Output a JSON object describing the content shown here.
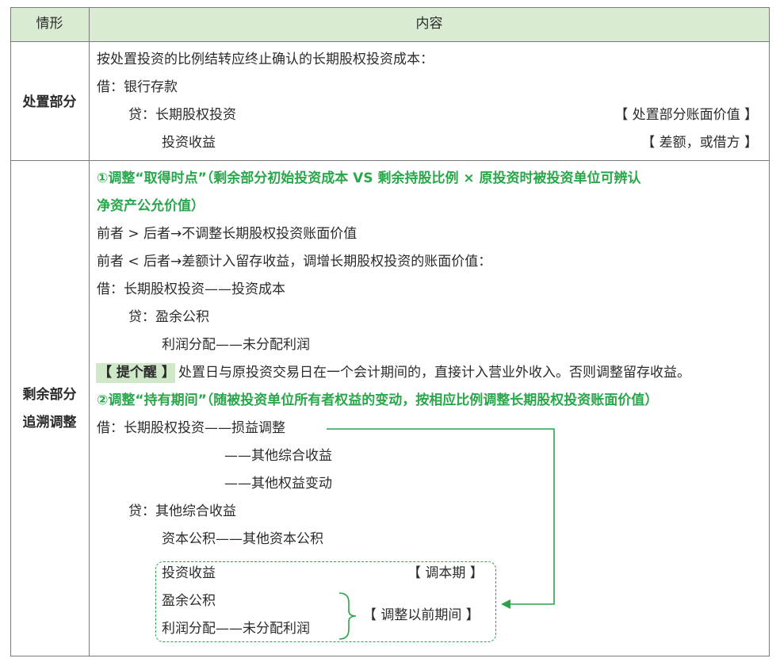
{
  "header": {
    "col1": "情形",
    "col2": "内容"
  },
  "row1": {
    "label": "处置部分",
    "lines": [
      "按处置投资的比例结转应终止确认的长期股权投资成本：",
      "借：银行存款",
      "贷：长期股权投资",
      "投资收益"
    ],
    "notes": [
      "【 处置部分账面价值 】",
      "【 差额，或借方 】"
    ]
  },
  "row2": {
    "label_1": "剩余部分",
    "label_2": "追溯调整",
    "heading1_a": "①调整“取得时点”（剩余部分初始投资成本 VS 剩余持股比例 × 原投资时被投资单位可辨认",
    "heading1_b": "净资产公允价值）",
    "lines1": [
      "前者 > 后者→不调整长期股权投资账面价值",
      "前者 < 后者→差额计入留存收益，调增长期股权投资的账面价值：",
      "借：长期股权投资——投资成本",
      "贷：盈余公积",
      "利润分配——未分配利润"
    ],
    "tip_label": "【 提个醒 】",
    "tip_text": "处置日与原投资交易日在一个会计期间的，直接计入营业外收入。否则调整留存收益。",
    "heading2": "②调整“持有期间”（随被投资单位所有者权益的变动，按相应比例调整长期股权投资账面价值）",
    "lines2": [
      "借：长期股权投资——损益调整",
      "——其他综合收益",
      "——其他权益变动",
      "贷：其他综合收益",
      "资本公积——其他资本公积"
    ],
    "box_lines": [
      "投资收益",
      "盈余公积",
      "利润分配——未分配利润"
    ],
    "box_note_current": "【 调本期 】",
    "box_note_prior": "【 调整以前期间 】"
  },
  "colors": {
    "accent": "#29a74a",
    "header_bg": "#d9ecd3",
    "tip_bg": "#cfe8c8",
    "border": "#7a7a7a"
  }
}
